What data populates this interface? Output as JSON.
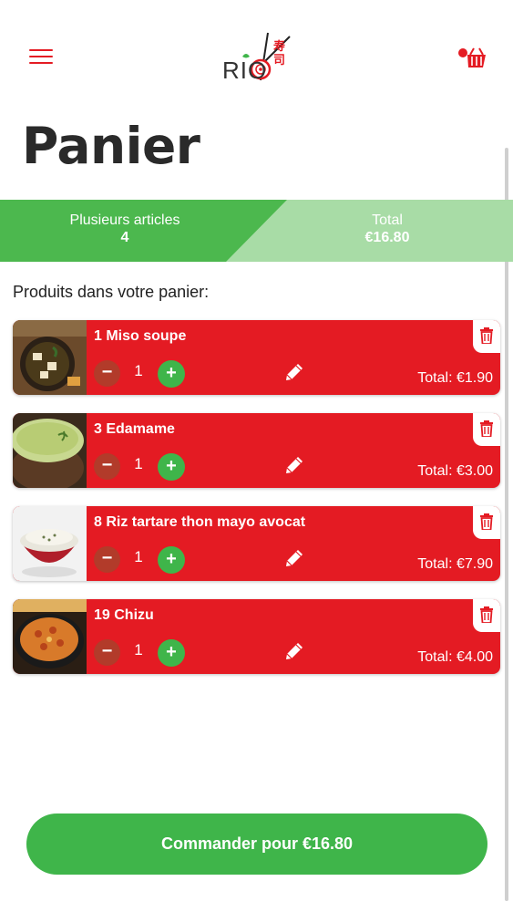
{
  "header": {
    "logo_text": "RIO",
    "logo_glyphs": "寿司",
    "menu_icon": "hamburger-menu-icon",
    "cart_icon": "shopping-basket-icon"
  },
  "page": {
    "title": "Panier"
  },
  "summary": {
    "items_label": "Plusieurs articles",
    "items_value": "4",
    "total_label": "Total",
    "total_value": "€16.80",
    "left_color": "#4cb84e",
    "right_color": "#a8dca6"
  },
  "cart": {
    "section_label": "Produits dans votre panier:",
    "items": [
      {
        "name": "1 Miso soupe",
        "quantity": "1",
        "total": "Total: €1.90",
        "image": "miso-soup"
      },
      {
        "name": "3 Edamame",
        "quantity": "1",
        "total": "Total: €3.00",
        "image": "green-soup"
      },
      {
        "name": "8 Riz tartare thon mayo avocat",
        "quantity": "1",
        "total": "Total: €7.90",
        "image": "rice-bowl"
      },
      {
        "name": "19 Chizu",
        "quantity": "1",
        "total": "Total: €4.00",
        "image": "cheese-dish"
      }
    ],
    "minus_label": "−",
    "plus_label": "+"
  },
  "checkout": {
    "label": "Commander pour €16.80"
  },
  "colors": {
    "accent_red": "#e41b23",
    "accent_green": "#3fb54a"
  }
}
